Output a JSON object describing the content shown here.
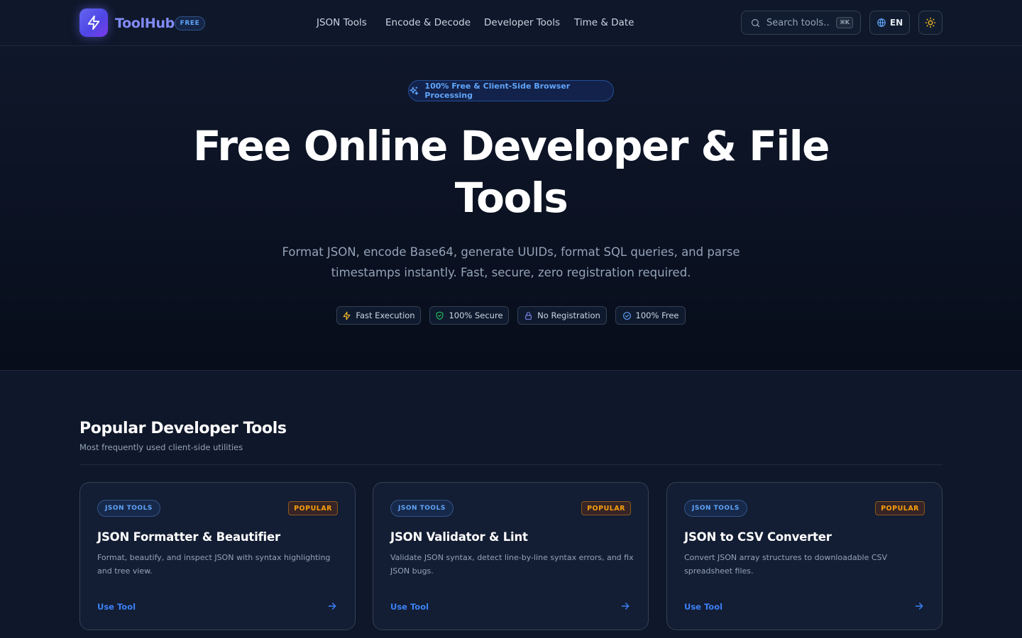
{
  "header": {
    "brand_name": "ToolHub",
    "brand_badge": "FREE",
    "nav": [
      {
        "label": "JSON Tools"
      },
      {
        "label": "Encode & Decode"
      },
      {
        "label": "Developer Tools"
      },
      {
        "label": "Time & Date"
      }
    ],
    "search": {
      "placeholder": "Search tools...",
      "shortcut": "⌘K"
    },
    "language": "EN",
    "icons": {
      "logo": "bolt-icon",
      "search": "search-icon",
      "language": "globe-icon",
      "theme": "sun-icon"
    }
  },
  "hero": {
    "pill": "100% Free & Client-Side Browser Processing",
    "title": "Free Online Developer & File Tools",
    "subtitle": "Format JSON, encode Base64, generate UUIDs, format SQL queries, and parse timestamps instantly. Fast, secure, zero registration required.",
    "features": [
      {
        "label": "Fast Execution",
        "icon": "bolt-icon"
      },
      {
        "label": "100% Secure",
        "icon": "shield-icon"
      },
      {
        "label": "No Registration",
        "icon": "lock-icon"
      },
      {
        "label": "100% Free",
        "icon": "check-circle-icon"
      }
    ]
  },
  "popular": {
    "title": "Popular Developer Tools",
    "subtitle": "Most frequently used client-side utilities",
    "cards": [
      {
        "category": "JSON TOOLS",
        "badge": "POPULAR",
        "title": "JSON Formatter & Beautifier",
        "description": "Format, beautify, and inspect JSON with syntax highlighting and tree view.",
        "link": "Use Tool"
      },
      {
        "category": "JSON TOOLS",
        "badge": "POPULAR",
        "title": "JSON Validator & Lint",
        "description": "Validate JSON syntax, detect line-by-line syntax errors, and fix JSON bugs.",
        "link": "Use Tool"
      },
      {
        "category": "JSON TOOLS",
        "badge": "POPULAR",
        "title": "JSON to CSV Converter",
        "description": "Convert JSON array structures to downloadable CSV spreadsheet files.",
        "link": "Use Tool"
      }
    ]
  },
  "colors": {
    "background": "#0f172a",
    "accent": "#3b82f6",
    "brand": "#818cf8",
    "popular": "#f59e0b"
  }
}
